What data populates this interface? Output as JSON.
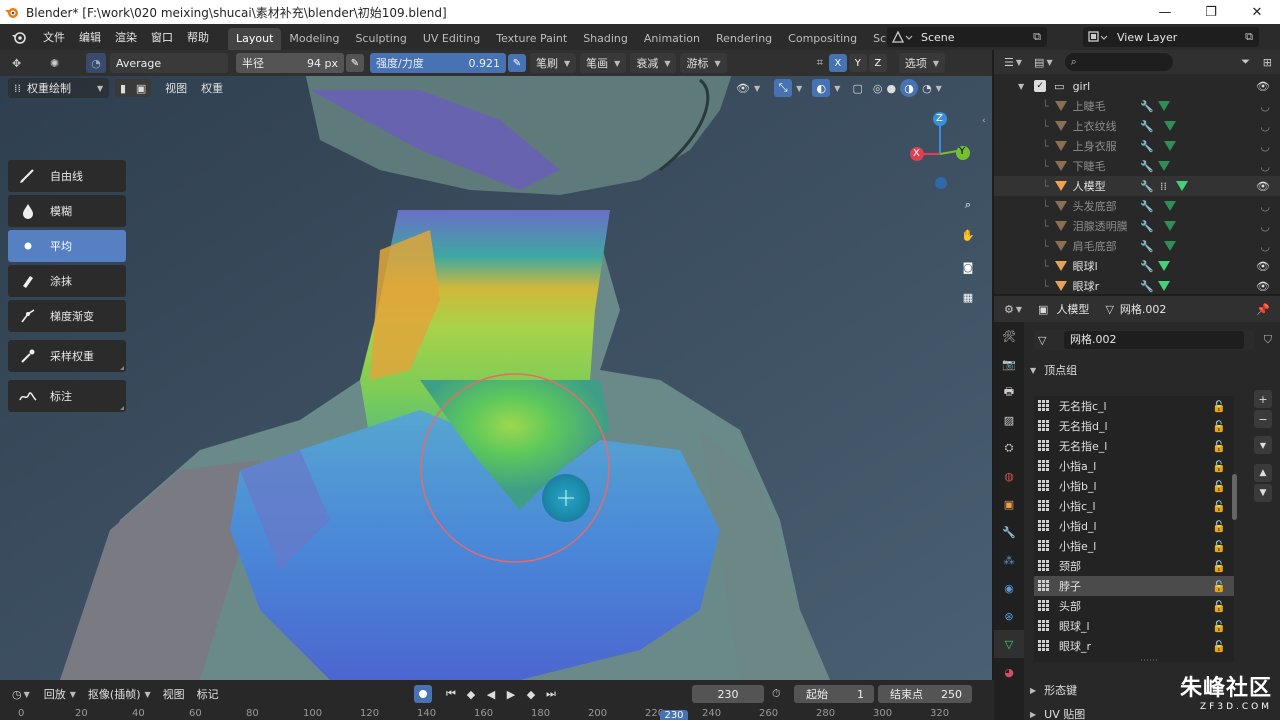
{
  "window": {
    "title": "Blender* [F:\\work\\020 meixing\\shucai\\素材补充\\blender\\初始109.blend]",
    "icons": [
      "blender-logo-icon",
      "minimize-icon",
      "maximize-icon",
      "close-icon"
    ]
  },
  "menubar": {
    "items": [
      "文件",
      "编辑",
      "渲染",
      "窗口",
      "帮助"
    ],
    "workspaces": [
      "Layout",
      "Modeling",
      "Sculpting",
      "UV Editing",
      "Texture Paint",
      "Shading",
      "Animation",
      "Rendering",
      "Compositing",
      "Sc"
    ],
    "active_workspace": "Layout",
    "scene": "Scene",
    "view_layer": "View Layer"
  },
  "tool_header": {
    "brush_name": "Average",
    "radius_label": "半径",
    "radius_value": "94 px",
    "strength_label": "强度/力度",
    "strength_value": "0.921",
    "dropdowns": [
      "笔刷",
      "笔画",
      "衰减",
      "游标"
    ],
    "axes": [
      "X",
      "Y",
      "Z"
    ],
    "options_label": "选项"
  },
  "mode_header": {
    "mode": "权重绘制",
    "menus": [
      "视图",
      "权重"
    ]
  },
  "toolshelf": {
    "tools": [
      {
        "label": "自由线",
        "icon": "draw-brush-icon"
      },
      {
        "label": "模糊",
        "icon": "blur-drop-icon"
      },
      {
        "label": "平均",
        "icon": "average-dot-icon"
      },
      {
        "label": "涂抹",
        "icon": "smear-brush-icon"
      },
      {
        "label": "梯度渐变",
        "icon": "gradient-icon"
      },
      {
        "label": "采样权重",
        "icon": "eyedropper-icon"
      },
      {
        "label": "标注",
        "icon": "annotate-icon"
      }
    ],
    "active_tool": "平均"
  },
  "gizmo": {
    "x": "X",
    "y": "Y",
    "z": "Z"
  },
  "outliner": {
    "root": "girl",
    "rows": [
      {
        "name": "上睫毛",
        "dim": true
      },
      {
        "name": "上衣纹线",
        "dim": true
      },
      {
        "name": "上身衣服",
        "dim": true
      },
      {
        "name": "下睫毛",
        "dim": true
      },
      {
        "name": "人模型",
        "dim": false,
        "selected": true
      },
      {
        "name": "头发底部",
        "dim": true
      },
      {
        "name": "泪腺透明膜",
        "dim": true
      },
      {
        "name": "肩毛底部",
        "dim": true
      },
      {
        "name": "眼球l",
        "dim": false
      },
      {
        "name": "眼球r",
        "dim": false
      }
    ]
  },
  "properties": {
    "object_name": "人模型",
    "mesh_name": "网格.002",
    "mesh_field": "网格.002",
    "vertex_groups_title": "顶点组",
    "vertex_groups": [
      "无名指c_l",
      "无名指d_l",
      "无名指e_l",
      "小指a_l",
      "小指b_l",
      "小指c_l",
      "小指d_l",
      "小指e_l",
      "颈部",
      "脖子",
      "头部",
      "眼球_l",
      "眼球_r"
    ],
    "selected_group": "脖子",
    "collapsed_panels": [
      "形态键",
      "UV 贴图"
    ]
  },
  "timeline": {
    "menus": [
      "回放",
      "抠像(插帧)",
      "视图",
      "标记"
    ],
    "current_frame": "230",
    "start_label": "起始",
    "start_value": "1",
    "end_label": "结束点",
    "end_value": "250",
    "ruler": [
      "0",
      "20",
      "40",
      "60",
      "80",
      "100",
      "120",
      "140",
      "160",
      "180",
      "200",
      "220",
      "240",
      "260",
      "280",
      "300",
      "320"
    ],
    "ruler_current": "230"
  },
  "watermark": {
    "big": "朱峰社区",
    "small": "ZF3D.COM"
  },
  "colors": {
    "accent": "#4772b3",
    "header": "#303030",
    "panel": "#282828",
    "viewport_bg": "#3a4a5a"
  }
}
